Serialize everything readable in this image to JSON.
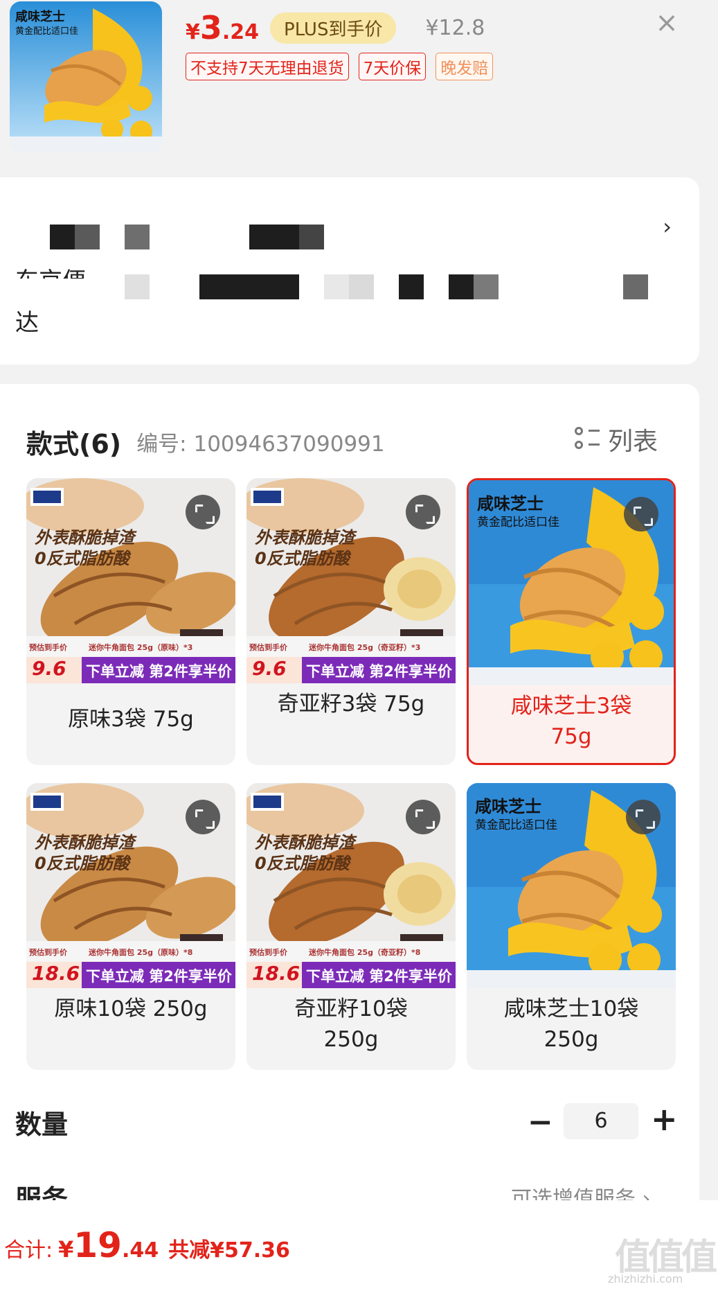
{
  "header": {
    "price_currency": "¥",
    "price_int": "3",
    "price_dec": ".24",
    "plus_tag": "PLUS到手价",
    "original_price": "¥12.8",
    "close_label": "×",
    "tags": [
      "不支持7天无理由退货",
      "7天价保",
      "晚发赔"
    ],
    "thumb": {
      "title": "咸味芝士",
      "subtitle": "黄金配比适口佳"
    }
  },
  "address": {
    "chevron": "›",
    "line_partial": "东京便",
    "line2": "达"
  },
  "styles": {
    "title": "款式(6)",
    "code": "编号: 10094637090991",
    "view_label": "列表",
    "items": [
      {
        "label": "原味3袋 75g",
        "img_type": "plain",
        "promo_price": "9.6",
        "promo_text": "下单立减 第2件享半价",
        "top_text1": "外表酥脆掉渣",
        "top_text2": "0反式脂肪酸",
        "price_tag": "预估到手价",
        "pack_text": "迷你牛角面包 25g（原味）*3",
        "selected": false
      },
      {
        "label": "奇亚籽3袋 75g",
        "img_type": "chia",
        "promo_price": "9.6",
        "promo_text": "下单立减 第2件享半价",
        "top_text1": "外表酥脆掉渣",
        "top_text2": "0反式脂肪酸",
        "price_tag": "预估到手价",
        "pack_text": "迷你牛角面包 25g（奇亚籽）*3",
        "selected": false
      },
      {
        "label": "咸味芝士3袋 75g",
        "img_type": "cheese",
        "img_title": "咸味芝士",
        "img_sub": "黄金配比适口佳",
        "selected": true
      },
      {
        "label": "原味10袋 250g",
        "img_type": "plain",
        "promo_price": "18.6",
        "promo_text": "下单立减 第2件享半价",
        "top_text1": "外表酥脆掉渣",
        "top_text2": "0反式脂肪酸",
        "price_tag": "预估到手价",
        "pack_text": "迷你牛角面包 25g（原味）*8",
        "selected": false
      },
      {
        "label": "奇亚籽10袋 250g",
        "img_type": "chia",
        "promo_price": "18.6",
        "promo_text": "下单立减 第2件享半价",
        "top_text1": "外表酥脆掉渣",
        "top_text2": "0反式脂肪酸",
        "price_tag": "预估到手价",
        "pack_text": "迷你牛角面包 25g（奇亚籽）*8",
        "selected": false
      },
      {
        "label": "咸味芝士10袋 250g",
        "img_type": "cheese",
        "img_title": "咸味芝士",
        "img_sub": "黄金配比适口佳",
        "selected": false
      }
    ]
  },
  "quantity": {
    "label": "数量",
    "value": "6",
    "minus": "−",
    "plus": "+"
  },
  "service": {
    "label": "服务",
    "value": "可选增值服务 ›"
  },
  "footer": {
    "total_label": "合计:",
    "currency": "¥",
    "total_int": "19",
    "total_dec": ".44",
    "saving": "共减¥57.36",
    "watermark": "值值值",
    "watermark_url": "zhizhizhi.com"
  },
  "colors": {
    "accent": "#e2231a",
    "tag_orange": "#f0905a",
    "plus_bg": "#f8e7a7"
  }
}
